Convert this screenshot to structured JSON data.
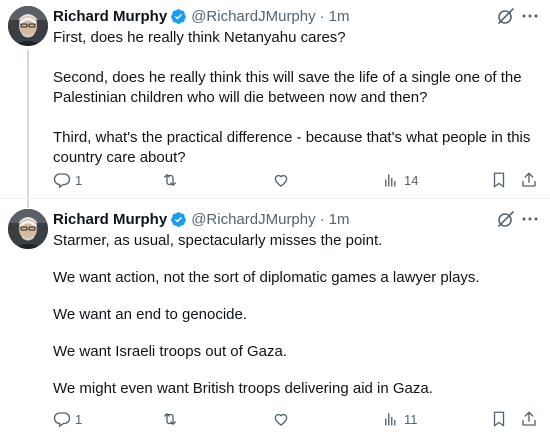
{
  "tweets": [
    {
      "author": {
        "name": "Richard Murphy",
        "handle": "@RichardJMurphy",
        "separator": "·",
        "time": "1m"
      },
      "paragraphs": [
        "First, does he really think Netanyahu cares?",
        "Second, does he really think this will save the life of a single one of the Palestinian children who will die between now and then?",
        "Third, what's the practical difference - because that's what people in this country care about?"
      ],
      "actions": {
        "replies": "1",
        "reposts": "",
        "likes": "",
        "views": "14"
      }
    },
    {
      "author": {
        "name": "Richard Murphy",
        "handle": "@RichardJMurphy",
        "separator": "·",
        "time": "1m"
      },
      "paragraphs": [
        "Starmer, as usual, spectacularly misses the point.",
        "We want action, not the sort of diplomatic games a lawyer plays.",
        "We want an end to genocide.",
        "We want Israeli troops out of Gaza.",
        "We might even want British troops delivering aid in Gaza."
      ],
      "actions": {
        "replies": "1",
        "reposts": "",
        "likes": "",
        "views": "11"
      }
    }
  ],
  "icons": {
    "verified": "verified-badge-icon",
    "grok": "grok-icon",
    "more": "more-icon",
    "reply": "reply-icon",
    "repost": "repost-icon",
    "like": "like-icon",
    "views": "views-icon",
    "bookmark": "bookmark-icon",
    "share": "share-icon"
  },
  "colors": {
    "text": "#0f1419",
    "secondary": "#536471",
    "verified": "#1d9bf0",
    "divider": "#eff3f4",
    "thread_line": "#cfd9de"
  }
}
